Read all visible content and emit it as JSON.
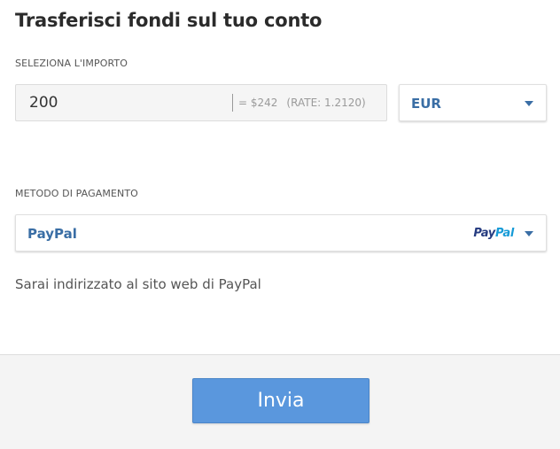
{
  "dialog": {
    "title": "Trasferisci fondi sul tuo conto"
  },
  "amount_section": {
    "label": "SELEZIONA L'IMPORTO",
    "amount_value": "200",
    "converted": "= $242",
    "rate": "(RATE: 1.2120)"
  },
  "currency_select": {
    "selected": "EUR",
    "icon": "chevron-down-icon"
  },
  "payment_section": {
    "label": "METODO DI PAGAMENTO",
    "selected": "PayPal",
    "logo_pay": "Pay",
    "logo_pal": "Pal",
    "icon": "chevron-down-icon"
  },
  "info": {
    "redirect_text": "Sarai indirizzato al sito web di PayPal"
  },
  "footer": {
    "submit_label": "Invia"
  },
  "colors": {
    "accent_text": "#3a6ea5",
    "button_bg": "#5a97dd",
    "paypal_dark": "#253b80",
    "paypal_light": "#179bd7"
  }
}
